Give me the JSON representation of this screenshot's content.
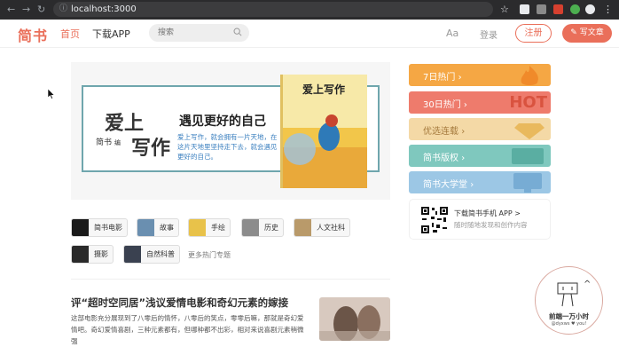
{
  "browser": {
    "url": "localhost:3000"
  },
  "header": {
    "logo": "简书",
    "nav_home": "首页",
    "nav_app": "下载APP",
    "search_placeholder": "搜索",
    "font_toggle": "Aa",
    "login": "登录",
    "register": "注册",
    "write": "写文章"
  },
  "banner": {
    "title_line1": "爱上",
    "title_line2": "写作",
    "brand": "简书",
    "brand_suffix": "编",
    "slogan": "遇见更好的自己",
    "description": "爱上写作，就会拥有一片天地，在这片天地里坚持走下去，就会遇见更好的自己。",
    "book_title": "爱上写作"
  },
  "topics": [
    {
      "label": "简书电影",
      "thumb_color": "#1a1a1a"
    },
    {
      "label": "故事",
      "thumb_color": "#6a8fb0"
    },
    {
      "label": "手绘",
      "thumb_color": "#e8c24a"
    },
    {
      "label": "历史",
      "thumb_color": "#8c8c8c"
    },
    {
      "label": "人文社科",
      "thumb_color": "#b99a6a"
    },
    {
      "label": "摄影",
      "thumb_color": "#2a2a2a"
    },
    {
      "label": "自然科普",
      "thumb_color": "#3a4150"
    }
  ],
  "more_topics": "更多热门专题",
  "article": {
    "title": "评“超时空同居”浅议爱情电影和奇幻元素的嫁接",
    "abstract": "这部电影充分展现到了八零后的情怀，八零后的笑点，零零后嘛，那就是奇幻爱情吧。奇幻爱情喜剧，三种元素都有，但哪种都不出彩，相对来说喜剧元素稍微强"
  },
  "boards": [
    {
      "label": "7日热门",
      "color": "#f5a744",
      "arrow": "›"
    },
    {
      "label": "30日热门",
      "color": "#ee7b6c",
      "arrow": "›"
    },
    {
      "label": "优选连载",
      "color": "#f4d9a6",
      "arrow": "›"
    },
    {
      "label": "简书版权",
      "color": "#7fc8be",
      "arrow": "›"
    },
    {
      "label": "简书大学堂",
      "color": "#9cc7e5",
      "arrow": "›"
    }
  ],
  "board_deco_text": "HOT",
  "app_download": {
    "title": "下载简书手机 APP >",
    "description": "随时随地发现和创作内容"
  },
  "badge": {
    "caret": "^",
    "name": "前端一万小时",
    "tagline": "@dyxws ♥ you!"
  },
  "colors": {
    "brand": "#ea6f5a"
  }
}
